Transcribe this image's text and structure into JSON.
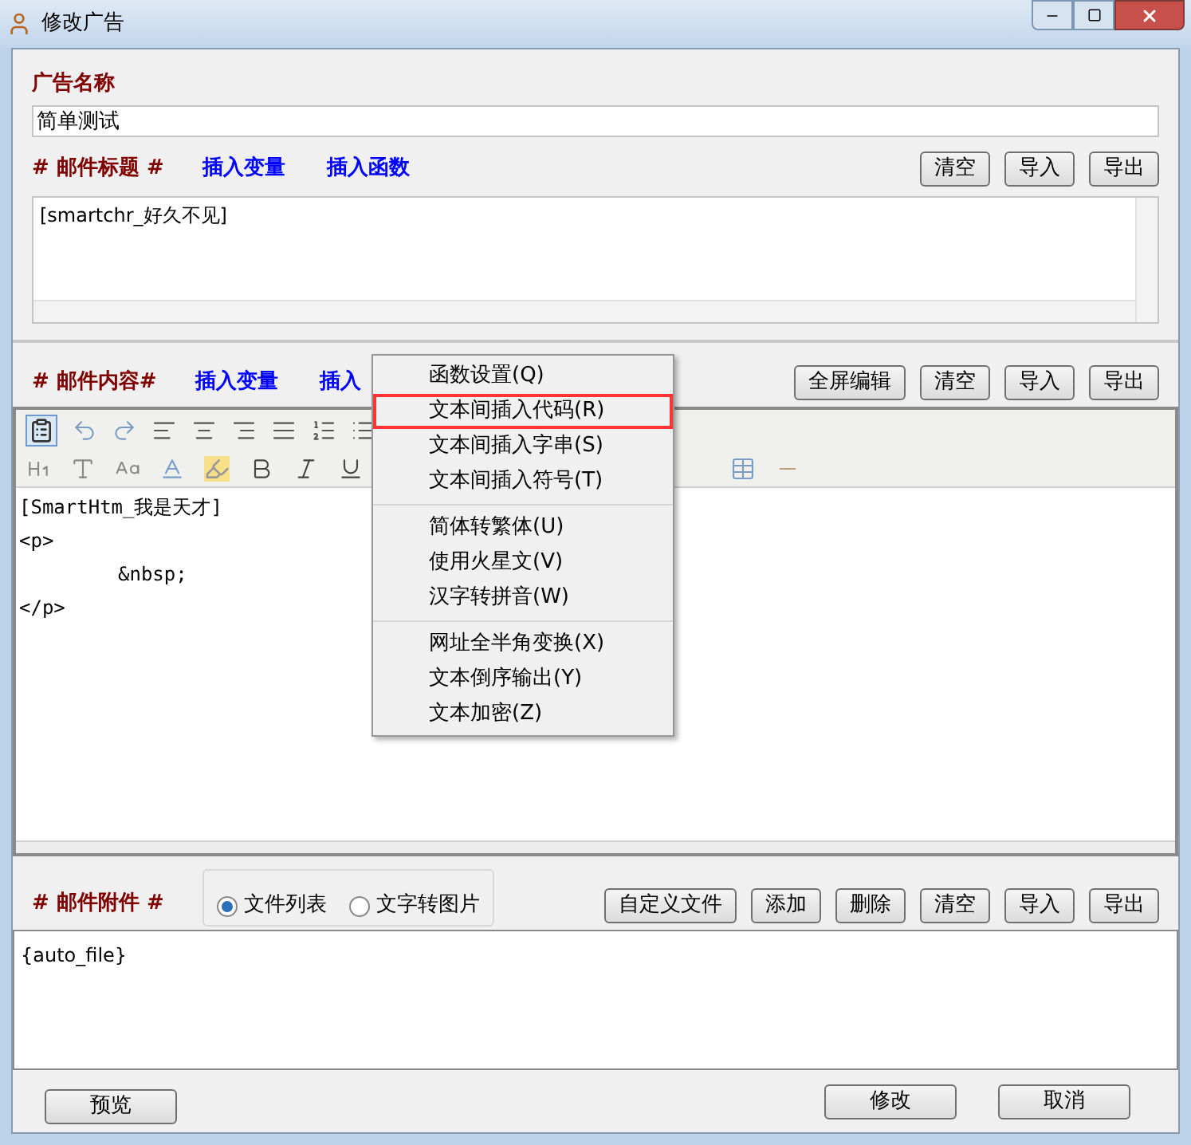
{
  "window": {
    "title": "修改广告"
  },
  "ad_name": {
    "label": "广告名称",
    "value": "简单测试"
  },
  "subject": {
    "label": "# 邮件标题 #",
    "links": [
      "插入变量",
      "插入函数"
    ],
    "buttons": [
      "清空",
      "导入",
      "导出"
    ],
    "value": "[smartchr_好久不见]"
  },
  "content": {
    "label": "# 邮件内容#",
    "links": [
      "插入变量",
      "插入"
    ],
    "buttons": [
      "全屏编辑",
      "清空",
      "导入",
      "导出"
    ],
    "lines": [
      {
        "text": "[SmartHtm_我是天才]"
      },
      {
        "text": "<p>",
        "children": [
          {
            "text": "&nbsp;"
          }
        ]
      },
      {
        "text": "</p>"
      }
    ]
  },
  "context_menu": {
    "groups": [
      [
        {
          "label": "函数设置(Q)",
          "highlighted": false
        },
        {
          "label": "文本间插入代码(R)",
          "highlighted": true
        },
        {
          "label": "文本间插入字串(S)",
          "highlighted": false
        },
        {
          "label": "文本间插入符号(T)",
          "highlighted": false
        }
      ],
      [
        {
          "label": "简体转繁体(U)",
          "highlighted": false
        },
        {
          "label": "使用火星文(V)",
          "highlighted": false
        },
        {
          "label": "汉字转拼音(W)",
          "highlighted": false
        }
      ],
      [
        {
          "label": "网址全半角变换(X)",
          "highlighted": false
        },
        {
          "label": "文本倒序输出(Y)",
          "highlighted": false
        },
        {
          "label": "文本加密(Z)",
          "highlighted": false
        }
      ]
    ]
  },
  "attachment": {
    "label": "# 邮件附件 #",
    "options": [
      {
        "label": "文件列表",
        "selected": true
      },
      {
        "label": "文字转图片",
        "selected": false
      }
    ],
    "buttons": [
      "自定义文件",
      "添加",
      "删除",
      "清空",
      "导入",
      "导出"
    ],
    "value": "{auto_file}"
  },
  "footer": {
    "left": [
      "预览"
    ],
    "right": [
      "修改",
      "取消"
    ]
  }
}
